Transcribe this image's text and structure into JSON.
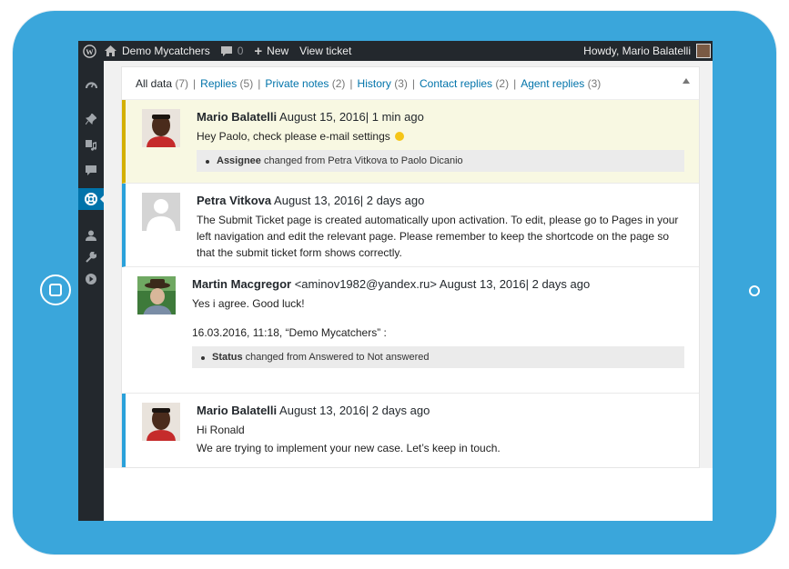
{
  "adminbar": {
    "site_name": "Demo Mycatchers",
    "comments_count": "0",
    "new_label": "New",
    "view_ticket_label": "View ticket",
    "howdy": "Howdy, Mario Balatelli"
  },
  "tabs": [
    {
      "label": "All data",
      "count": "(7)"
    },
    {
      "label": "Replies",
      "count": "(5)"
    },
    {
      "label": "Private notes",
      "count": "(2)"
    },
    {
      "label": "History",
      "count": "(3)"
    },
    {
      "label": "Contact replies",
      "count": "(2)"
    },
    {
      "label": "Agent replies",
      "count": "(3)"
    }
  ],
  "separator": "|",
  "entries": [
    {
      "author": "Mario Balatelli",
      "meta": "August 15, 2016| 1 min ago",
      "text": "Hey Paolo, check please e-mail settings",
      "note_field": "Assignee",
      "note_text": " changed from Petra Vitkova to Paolo Dicanio"
    },
    {
      "author": "Petra Vitkova",
      "meta": "August 13, 2016| 2 days ago",
      "text": "The Submit Ticket page is created automatically upon activation. To edit, please go to Pages in your left navigation and edit the relevant page. Please remember to keep the shortcode on the page so that the submit ticket form shows correctly."
    },
    {
      "author": "Martin Macgregor",
      "email": "<aminov1982@yandex.ru>",
      "meta": "August 13, 2016| 2 days ago",
      "text": "Yes i agree. Good luck!",
      "quote": "16.03.2016, 11:18, “Demo Mycatchers” :",
      "note_field": "Status",
      "note_text": " changed from Answered to Not answered"
    },
    {
      "author": "Mario Balatelli",
      "meta": "August 13, 2016| 2 days ago",
      "text": "Hi Ronald",
      "text2": "We are trying to implement your new case. Let’s keep in touch."
    }
  ],
  "colors": {
    "tablet": "#3aa6db",
    "admin_bar": "#23282d",
    "active_menu": "#0073aa",
    "link": "#0073aa",
    "private_note_bg": "#f8f8e2",
    "private_note_border": "#d4b000",
    "reply_border": "#2aa1da"
  }
}
